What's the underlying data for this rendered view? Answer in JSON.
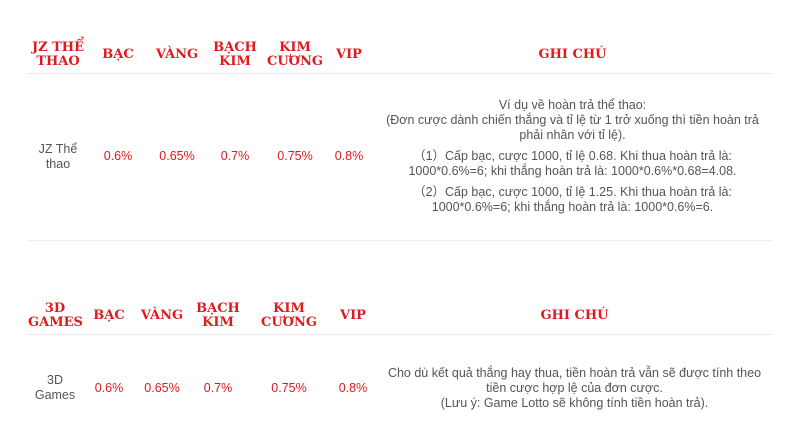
{
  "sports_table": {
    "headers": [
      "JZ THỂ THAO",
      "BẠC",
      "VÀNG",
      "BẠCH KIM",
      "KIM CƯƠNG",
      "VIP",
      "GHI CHÚ"
    ],
    "row": {
      "game": "JZ Thể thao",
      "values": [
        "0.6%",
        "0.65%",
        "0.7%",
        "0.75%",
        "0.8%"
      ],
      "note_lines": [
        "Ví dụ về hoàn trả thể thao:",
        "(Đơn cược dành chiến thắng và tỉ lệ từ 1 trở xuống thì tiền hoàn trả phải nhân với tỉ lệ).",
        "（1）Cấp bạc, cược 1000, tỉ lệ 0.68. Khi thua hoàn trả là: 1000*0.6%=6; khi thắng hoàn trả là: 1000*0.6%*0.68=4.08.",
        "（2）Cấp bạc, cược 1000, tỉ lệ 1.25. Khi thua hoàn trả là: 1000*0.6%=6; khi thắng hoàn trả là: 1000*0.6%=6."
      ]
    }
  },
  "games_table": {
    "headers": [
      "3D GAMES",
      "BẠC",
      "VÀNG",
      "BẠCH KIM",
      "KIM CƯƠNG",
      "VIP",
      "GHI CHÚ"
    ],
    "row": {
      "game": "3D Games",
      "values": [
        "0.6%",
        "0.65%",
        "0.7%",
        "0.75%",
        "0.8%"
      ],
      "note_lines": [
        "Cho dù kết quả thắng hay thua, tiền hoàn trả vẫn sẽ được tính theo tiền cược hợp lệ của đơn cược.",
        "(Lưu ý: Game Lotto sẽ không tính tiền hoàn trả)."
      ]
    }
  },
  "colors": {
    "accent": "#e0191f",
    "text": "#555555",
    "divider": "#ececec"
  }
}
